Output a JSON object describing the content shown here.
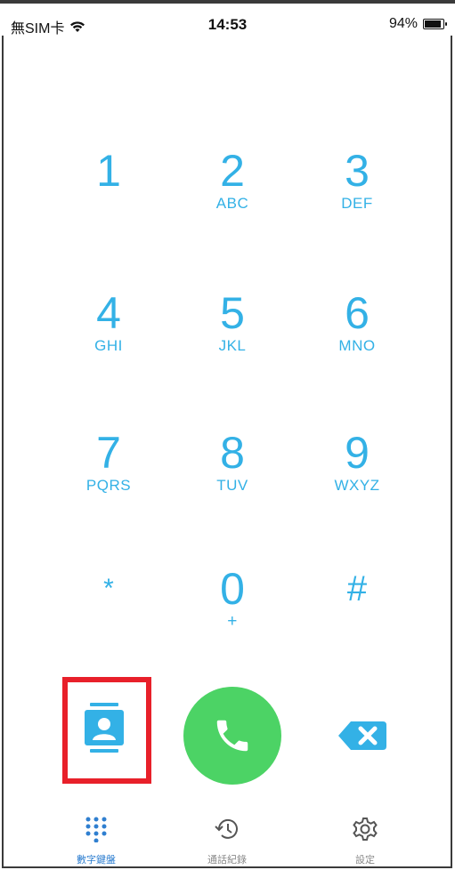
{
  "status_bar": {
    "carrier": "無SIM卡",
    "time": "14:53",
    "battery": "94%",
    "battery_level": 0.94
  },
  "keypad": {
    "keys": [
      {
        "digit": "1",
        "letters": ""
      },
      {
        "digit": "2",
        "letters": "ABC"
      },
      {
        "digit": "3",
        "letters": "DEF"
      },
      {
        "digit": "4",
        "letters": "GHI"
      },
      {
        "digit": "5",
        "letters": "JKL"
      },
      {
        "digit": "6",
        "letters": "MNO"
      },
      {
        "digit": "7",
        "letters": "PQRS"
      },
      {
        "digit": "8",
        "letters": "TUV"
      },
      {
        "digit": "9",
        "letters": "WXYZ"
      },
      {
        "digit": "*",
        "letters": ""
      },
      {
        "digit": "0",
        "letters": "+"
      },
      {
        "digit": "#",
        "letters": ""
      }
    ]
  },
  "actions": {
    "contacts_icon": "contacts-icon",
    "call_icon": "phone-icon",
    "delete_icon": "backspace-icon"
  },
  "tabs": [
    {
      "label": "數字鍵盤",
      "icon": "keypad-icon",
      "active": true
    },
    {
      "label": "通話紀錄",
      "icon": "history-icon",
      "active": false
    },
    {
      "label": "設定",
      "icon": "gear-icon",
      "active": false
    }
  ],
  "colors": {
    "accent": "#33b1e6",
    "call": "#4cd365",
    "highlight": "#e8202a",
    "tab_active": "#2f7fd0"
  }
}
